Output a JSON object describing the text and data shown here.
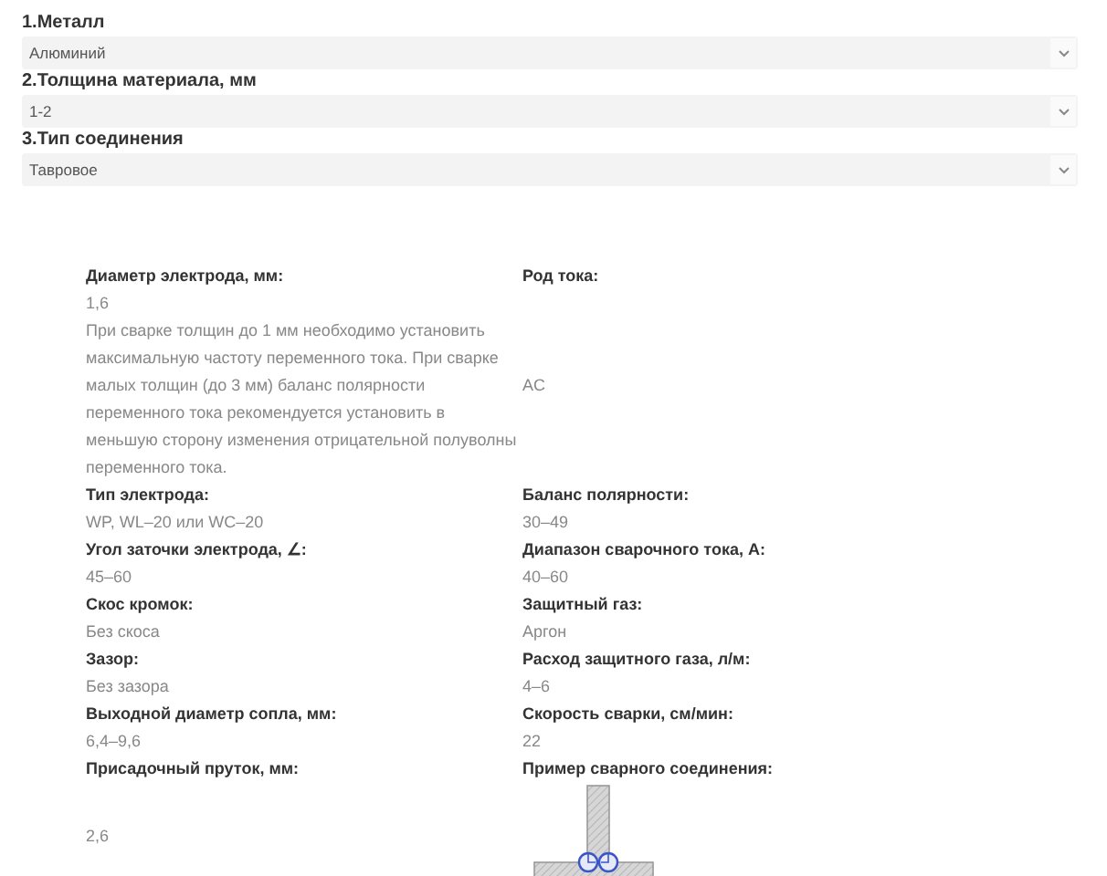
{
  "selects": [
    {
      "label": "1.Металл",
      "value": "Алюминий"
    },
    {
      "label": "2.Толщина материала, мм",
      "value": "1-2"
    },
    {
      "label": "3.Тип соединения",
      "value": "Тавровое"
    }
  ],
  "details": [
    [
      {
        "label": "Диаметр электрода, мм:",
        "value": "1,6",
        "note": "При сварке толщин до 1 мм необходимо установить максимальную частоту переменного тока. При сварке малых толщин (до 3 мм) баланс полярности переменного тока рекомендуется установить в меньшую сторону изменения отрицательной полуволны переменного тока."
      },
      {
        "label": "Род тока:",
        "value": "AC"
      }
    ],
    [
      {
        "label": "Тип электрода:",
        "value": "WP, WL–20 или WC–20"
      },
      {
        "label": "Баланс полярности:",
        "value": "30–49"
      }
    ],
    [
      {
        "label": "Угол заточки электрода, ∠:",
        "value": "45–60"
      },
      {
        "label": "Диапазон сварочного тока, А:",
        "value": "40–60"
      }
    ],
    [
      {
        "label": "Скос кромок:",
        "value": "Без скоса"
      },
      {
        "label": "Защитный газ:",
        "value": "Аргон"
      }
    ],
    [
      {
        "label": "Зазор:",
        "value": "Без зазора"
      },
      {
        "label": "Расход защитного газа, л/м:",
        "value": "4–6"
      }
    ],
    [
      {
        "label": "Выходной диаметр сопла, мм:",
        "value": "6,4–9,6"
      },
      {
        "label": "Скорость сварки, см/мин:",
        "value": "22"
      }
    ],
    [
      {
        "label": "Присадочный пруток, мм:",
        "value": "2,6"
      },
      {
        "label": "Пример сварного соединения:",
        "kind": "tee-joint"
      }
    ]
  ]
}
